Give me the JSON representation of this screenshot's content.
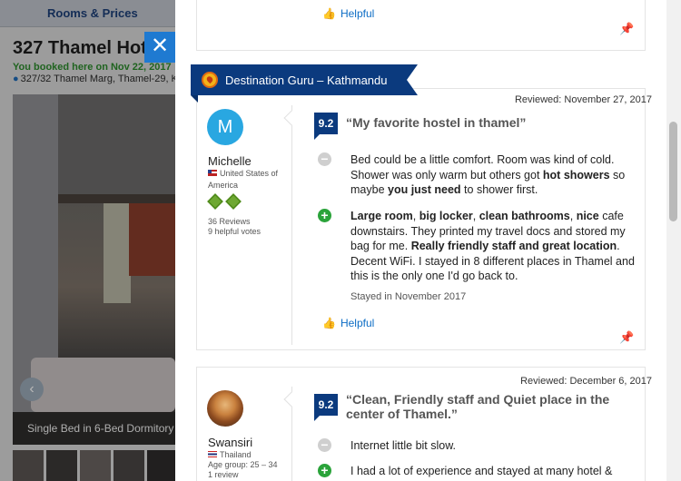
{
  "background": {
    "tab_label": "Rooms & Prices",
    "hotel_title": "327 Thamel Hot",
    "booked_note": "You booked here on Nov 22, 2017",
    "address": "327/32 Thamel Marg, Thamel-29, K",
    "photo_caption": "Single Bed in 6-Bed Dormitory",
    "prev_arrow": "‹"
  },
  "close_label": "✕",
  "previous_review": {
    "helpful_label": "Helpful"
  },
  "guru_banner": {
    "label": "Destination Guru – Kathmandu"
  },
  "reviews": [
    {
      "reviewed_date": "Reviewed: November 27, 2017",
      "avatar_initial": "M",
      "name": "Michelle",
      "country": "United States of America",
      "review_count": "36 Reviews",
      "helpful_votes": "9 helpful votes",
      "score": "9.2",
      "title": "“My favorite hostel in thamel”",
      "negative": {
        "parts": [
          {
            "text": "Bed could be a little comfort. Room was kind of cold. Shower was only warm but others got ",
            "bold": false
          },
          {
            "text": "hot showers",
            "bold": true
          },
          {
            "text": " so maybe ",
            "bold": false
          },
          {
            "text": "you just need",
            "bold": true
          },
          {
            "text": " to shower first.",
            "bold": false
          }
        ]
      },
      "positive": {
        "parts": [
          {
            "text": "Large room",
            "bold": true
          },
          {
            "text": ", ",
            "bold": false
          },
          {
            "text": "big locker",
            "bold": true
          },
          {
            "text": ", ",
            "bold": false
          },
          {
            "text": "clean bathrooms",
            "bold": true
          },
          {
            "text": ", ",
            "bold": false
          },
          {
            "text": "nice",
            "bold": true
          },
          {
            "text": " cafe downstairs. They printed my travel docs and stored my bag for me. ",
            "bold": false
          },
          {
            "text": "Really friendly staff and great location",
            "bold": true
          },
          {
            "text": ". Decent WiFi. I stayed in 8 different places in Thamel and this is the only one I'd go back to.",
            "bold": false
          }
        ]
      },
      "stayed": "Stayed in November 2017",
      "helpful_label": "Helpful"
    },
    {
      "reviewed_date": "Reviewed: December 6, 2017",
      "name": "Swansiri",
      "country": "Thailand",
      "age_group": "Age group: 25 – 34",
      "review_count": "1 review",
      "score": "9.2",
      "title": "“Clean, Friendly staff and Quiet place in the center of Thamel.”",
      "negative": "Internet little bit slow.",
      "positive": "I had a lot of experience and stayed at many hotel &"
    }
  ],
  "icons": {
    "thumb": "👍",
    "pin": "📌",
    "minus": "−",
    "plus": "+"
  },
  "colors": {
    "brand_blue": "#0b3a7e",
    "link_blue": "#0d6dc5",
    "positive_green": "#2aa33a",
    "negative_grey": "#cfcfcf",
    "avatar_blue": "#29a7e1"
  }
}
